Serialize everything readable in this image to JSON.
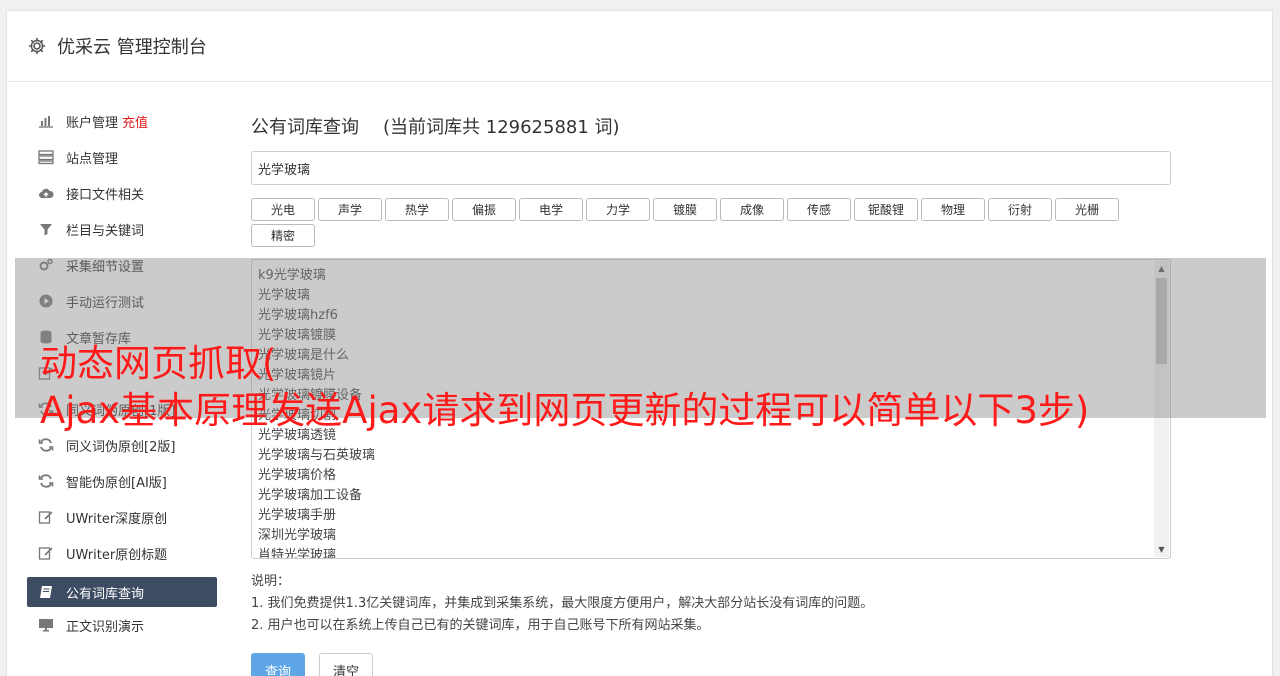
{
  "header": {
    "title": "优采云 管理控制台",
    "icon": "gear-icon"
  },
  "sidebar": {
    "items": [
      {
        "label": "账户管理",
        "extra": "充值",
        "icon": "bar-chart-icon"
      },
      {
        "label": "站点管理",
        "icon": "server-icon"
      },
      {
        "label": "接口文件相关",
        "icon": "cloud-upload-icon"
      },
      {
        "label": "栏目与关键词",
        "icon": "filter-icon"
      },
      {
        "label": "采集细节设置",
        "icon": "gears-icon"
      },
      {
        "label": "手动运行测试",
        "icon": "play-circle-icon"
      },
      {
        "label": "文章暂存库",
        "icon": "database-icon"
      },
      {
        "label": "",
        "icon": "edit-icon"
      },
      {
        "label": "同义词伪原创[1版]",
        "icon": "refresh-icon"
      },
      {
        "label": "同义词伪原创[2版]",
        "icon": "refresh-icon"
      },
      {
        "label": "智能伪原创[AI版]",
        "icon": "refresh-icon"
      },
      {
        "label": "UWriter深度原创",
        "icon": "edit-icon"
      },
      {
        "label": "UWriter原创标题",
        "icon": "edit-icon"
      },
      {
        "label": "公有词库查询",
        "icon": "book-icon",
        "active": true
      },
      {
        "label": "正文识别演示",
        "icon": "monitor-icon"
      }
    ]
  },
  "main": {
    "heading": "公有词库查询",
    "count_text": "(当前词库共 129625881 词)",
    "search_value": "光学玻璃",
    "tags": [
      "光电",
      "声学",
      "热学",
      "偏振",
      "电学",
      "力学",
      "镀膜",
      "成像",
      "传感",
      "铌酸锂",
      "物理",
      "衍射",
      "光栅",
      "精密"
    ],
    "results": [
      "k9光学玻璃",
      "光学玻璃",
      "光学玻璃hzf6",
      "光学玻璃镀膜",
      "光学玻璃是什么",
      "光学玻璃镜片",
      "光学玻璃镀膜设备",
      "光学玻璃切割",
      "光学玻璃透镜",
      "光学玻璃与石英玻璃",
      "光学玻璃价格",
      "光学玻璃加工设备",
      "光学玻璃手册",
      "深圳光学玻璃",
      "肖特光学玻璃"
    ],
    "notes_title": "说明：",
    "notes": [
      "1. 我们免费提供1.3亿关键词库，并集成到采集系统，最大限度方便用户，解决大部分站长没有词库的问题。",
      "2. 用户也可以在系统上传自己已有的关键词库，用于自己账号下所有网站采集。"
    ],
    "query_button": "查询",
    "clear_button": "清空"
  },
  "overlay": {
    "line1": "动态网页抓取(",
    "line2": "Ajax基本原理发送Ajax请求到网页更新的过程可以简单以下3步)"
  },
  "colors": {
    "accent": "#5ea6e6",
    "active_nav": "#3d4c63",
    "overlay_text": "#ff1a1a",
    "recharge": "#e02020"
  }
}
